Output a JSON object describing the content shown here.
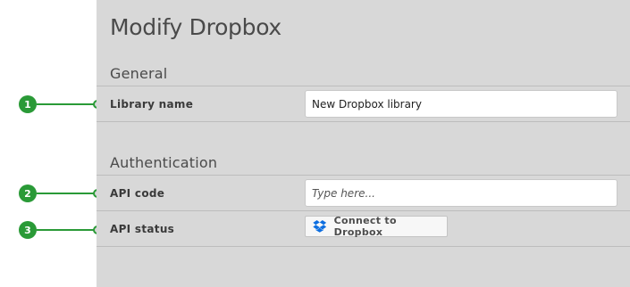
{
  "page": {
    "title": "Modify Dropbox"
  },
  "sections": {
    "general": {
      "title": "General",
      "library_name_label": "Library name",
      "library_name_value": "New Dropbox library"
    },
    "authentication": {
      "title": "Authentication",
      "api_code_label": "API code",
      "api_code_placeholder": "Type here...",
      "api_status_label": "API status",
      "connect_button_label": "Connect to Dropbox",
      "connect_button_icon": "dropbox-icon"
    }
  },
  "callouts": [
    "1",
    "2",
    "3"
  ],
  "colors": {
    "callout_green": "#2a9a37",
    "dropbox_blue": "#0d6ee0",
    "panel_gray": "#d8d8d8"
  }
}
